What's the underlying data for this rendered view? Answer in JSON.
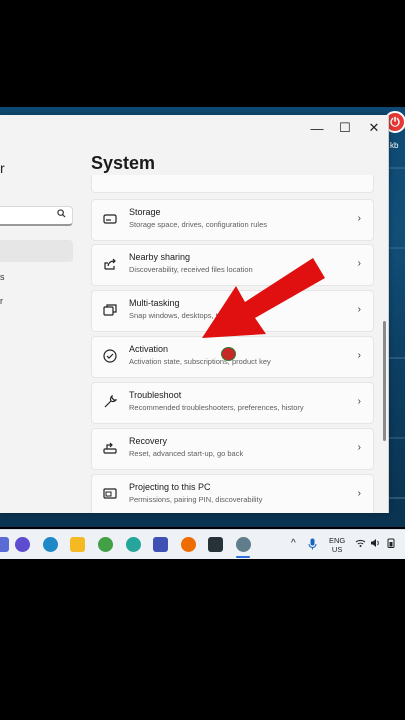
{
  "window": {
    "sidebar_letter": "r",
    "sidebar_frag_1": "s",
    "sidebar_frag_2": "r",
    "controls": {
      "minimize": "—",
      "maximize": "☐",
      "close": "✕"
    }
  },
  "page_title": "System",
  "settings_items": [
    {
      "title": "Storage",
      "description": "Storage space, drives, configuration rules",
      "icon": "storage-icon"
    },
    {
      "title": "Nearby sharing",
      "description": "Discoverability, received files location",
      "icon": "share-icon"
    },
    {
      "title": "Multi-tasking",
      "description": "Snap windows, desktops, t",
      "icon": "multitasking-icon"
    },
    {
      "title": "Activation",
      "description": "Activation state, subscriptions, product key",
      "icon": "activation-check-icon"
    },
    {
      "title": "Troubleshoot",
      "description": "Recommended troubleshooters, preferences, history",
      "icon": "wrench-icon"
    },
    {
      "title": "Recovery",
      "description": "Reset, advanced start-up, go back",
      "icon": "recovery-icon"
    },
    {
      "title": "Projecting to this PC",
      "description": "Permissions, pairing PIN, discoverability",
      "icon": "projector-icon"
    }
  ],
  "chevron": "›",
  "desktop_app_label": "kb",
  "taskbar": {
    "lang_line1": "ENG",
    "lang_line2": "US",
    "tray_chevron": "^"
  },
  "colors": {
    "accent": "#2f6fd6",
    "arrow": "#e01010"
  }
}
